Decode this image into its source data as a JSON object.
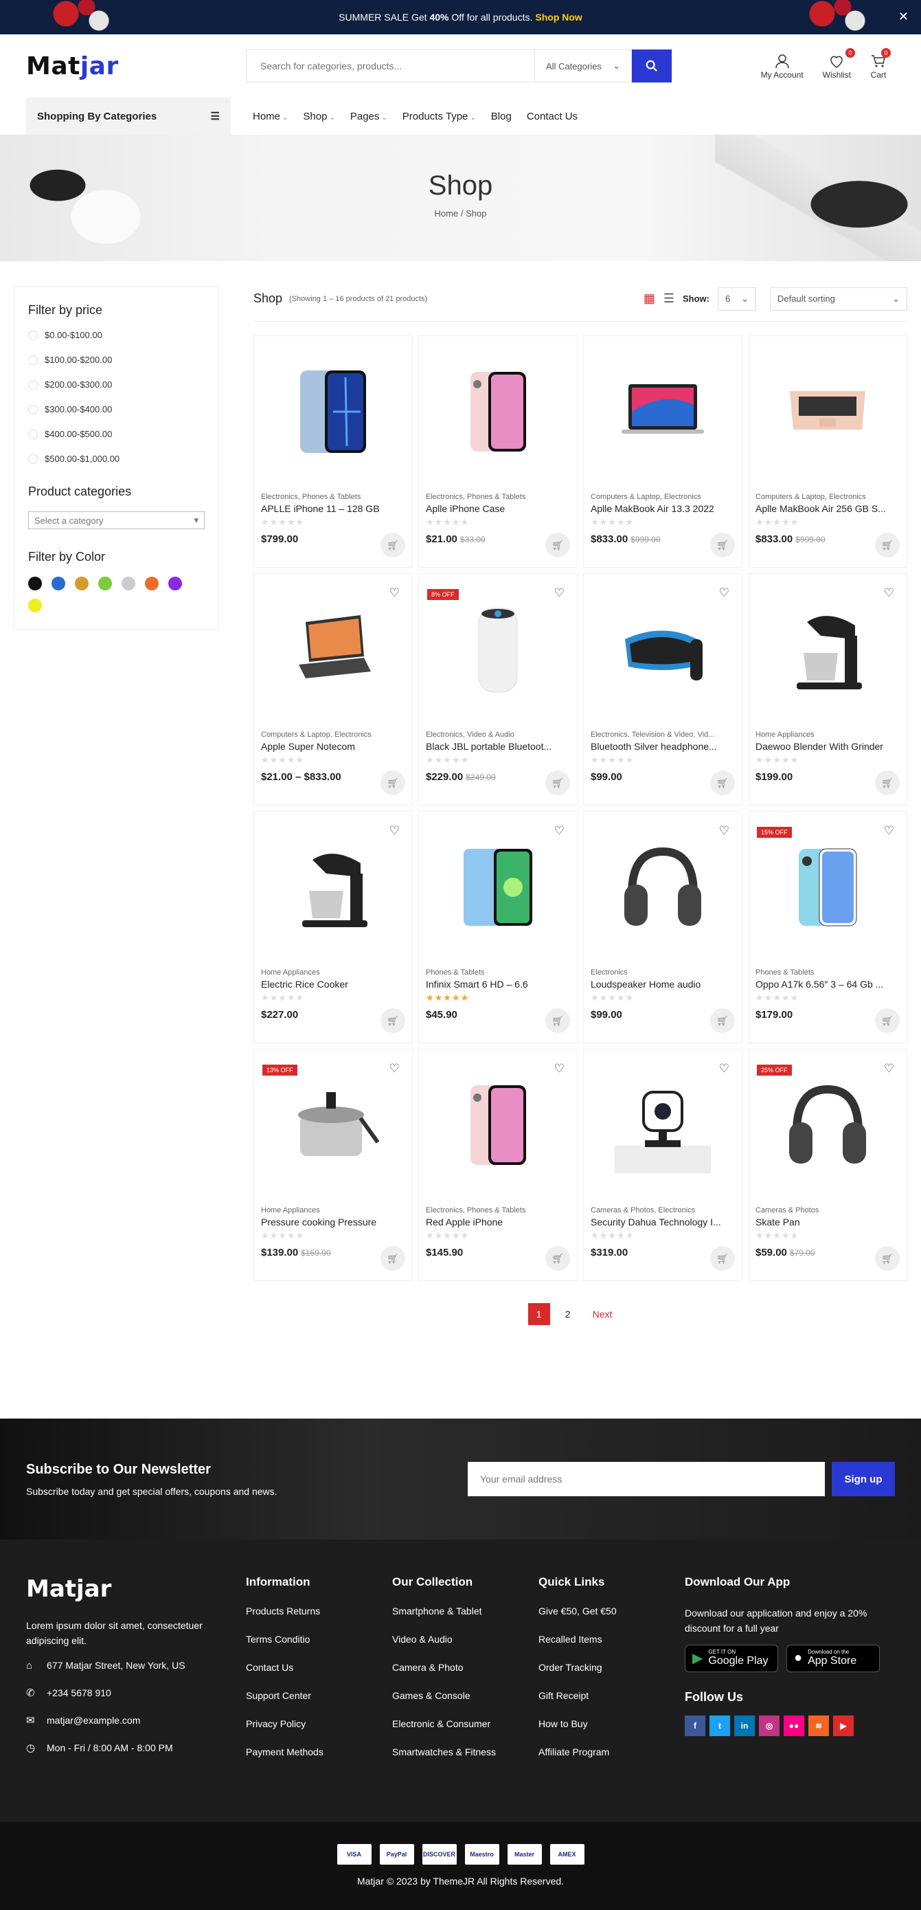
{
  "topbar": {
    "text_pre": "SUMMER SALE Get ",
    "text_bold": "40%",
    "text_post": " Off for all products.",
    "cta": "Shop Now",
    "close": "✕"
  },
  "header": {
    "logo_a": "Mat",
    "logo_b": "jar",
    "search_placeholder": "Search for categories, products...",
    "category_select": "All Categories",
    "account_label": "My Account",
    "wishlist_label": "Wishlist",
    "wishlist_count": "0",
    "cart_label": "Cart",
    "cart_count": "0"
  },
  "nav": {
    "categories_label": "Shopping By Categories",
    "menu": [
      {
        "label": "Home",
        "chevron": true
      },
      {
        "label": "Shop",
        "chevron": true
      },
      {
        "label": "Pages",
        "chevron": true
      },
      {
        "label": "Products Type",
        "chevron": true
      },
      {
        "label": "Blog",
        "chevron": false
      },
      {
        "label": "Contact Us",
        "chevron": false
      }
    ]
  },
  "hero": {
    "title": "Shop",
    "crumb_home": "Home",
    "crumb_sep": "/",
    "crumb_current": "Shop"
  },
  "sidebar": {
    "price_title": "Filter by price",
    "prices": [
      "$0.00-$100.00",
      "$100.00-$200.00",
      "$200.00-$300.00",
      "$300.00-$400.00",
      "$400.00-$500.00",
      "$500.00-$1,000.00"
    ],
    "categories_title": "Product categories",
    "category_placeholder": "Select a category",
    "color_title": "Filter by Color",
    "colors": [
      "#111111",
      "#2a6ad1",
      "#d99a2b",
      "#7ccb3a",
      "#cccccc",
      "#ee6a2d",
      "#8a2be2",
      "#eeee22"
    ]
  },
  "toolbar": {
    "title": "Shop",
    "count": "(Showing 1 – 16 products of 21 products)",
    "show_label": "Show:",
    "show_value": "6",
    "sort_value": "Default sorting"
  },
  "products": [
    {
      "cat": "Electronics, Phones & Tablets",
      "name": "APLLE iPhone 11 – 128 GB",
      "price": "$799.00",
      "old": "",
      "badge": "",
      "rated": false,
      "wish": false,
      "icon": "phone-blue-icon"
    },
    {
      "cat": "Electronics, Phones & Tablets",
      "name": "Aplle iPhone Case",
      "price": "$21.00",
      "old": "$33.00",
      "badge": "",
      "rated": false,
      "wish": false,
      "icon": "phone-pink-icon"
    },
    {
      "cat": "Computers & Laptop, Electronics",
      "name": "Aplle MakBook Air 13.3 2022",
      "price": "$833.00",
      "old": "$999.00",
      "badge": "",
      "rated": false,
      "wish": false,
      "icon": "laptop-icon"
    },
    {
      "cat": "Computers & Laptop, Electronics",
      "name": "Aplle MakBook Air 256 GB S...",
      "price": "$833.00",
      "old": "$999.00",
      "badge": "",
      "rated": false,
      "wish": false,
      "icon": "laptop-gold-icon"
    },
    {
      "cat": "Computers & Laptop, Electronics",
      "name": "Apple Super Notecom",
      "price": "$21.00 – $833.00",
      "old": "",
      "badge": "",
      "rated": false,
      "wish": true,
      "icon": "tablet-keyboard-icon"
    },
    {
      "cat": "Electronics, Video & Audio",
      "name": "Black JBL portable Bluetoot...",
      "price": "$229.00",
      "old": "$249.00",
      "badge": "8% OFF",
      "rated": false,
      "wish": true,
      "icon": "air-purifier-icon"
    },
    {
      "cat": "Electronics, Television & Video, Vid...",
      "name": "Bluetooth Silver headphone...",
      "price": "$99.00",
      "old": "",
      "badge": "",
      "rated": false,
      "wish": true,
      "icon": "vr-headset-icon"
    },
    {
      "cat": "Home Appliances",
      "name": "Daewoo Blender With Grinder",
      "price": "$199.00",
      "old": "",
      "badge": "",
      "rated": false,
      "wish": true,
      "icon": "stand-mixer-icon"
    },
    {
      "cat": "Home Appliances",
      "name": "Electric Rice Cooker",
      "price": "$227.00",
      "old": "",
      "badge": "",
      "rated": false,
      "wish": true,
      "icon": "stand-mixer-icon"
    },
    {
      "cat": "Phones & Tablets",
      "name": "Infinix Smart 6 HD – 6.6",
      "price": "$45.90",
      "old": "",
      "badge": "",
      "rated": true,
      "wish": true,
      "icon": "phone-android-icon"
    },
    {
      "cat": "Electronics",
      "name": "Loudspeaker Home audio",
      "price": "$99.00",
      "old": "",
      "badge": "",
      "rated": false,
      "wish": true,
      "icon": "headphones-icon"
    },
    {
      "cat": "Phones & Tablets",
      "name": "Oppo A17k 6.56″ 3 – 64 Gb ...",
      "price": "$179.00",
      "old": "",
      "badge": "15% OFF",
      "rated": false,
      "wish": true,
      "icon": "phone-oppo-icon"
    },
    {
      "cat": "Home Appliances",
      "name": "Pressure cooking Pressure",
      "price": "$139.00",
      "old": "$159.00",
      "badge": "13% OFF",
      "rated": false,
      "wish": true,
      "icon": "pressure-cooker-icon"
    },
    {
      "cat": "Electronics, Phones & Tablets",
      "name": "Red Apple iPhone",
      "price": "$145.90",
      "old": "",
      "badge": "",
      "rated": false,
      "wish": true,
      "icon": "phone-pink-icon"
    },
    {
      "cat": "Cameras & Photos, Electronics",
      "name": "Security Dahua Technology I...",
      "price": "$319.00",
      "old": "",
      "badge": "",
      "rated": false,
      "wish": true,
      "icon": "webcam-icon"
    },
    {
      "cat": "Cameras & Photos",
      "name": "Skate Pan",
      "price": "$59.00",
      "old": "$79.00",
      "badge": "25% OFF",
      "rated": false,
      "wish": true,
      "icon": "headphones-icon"
    }
  ],
  "pagination": {
    "p1": "1",
    "p2": "2",
    "next": "Next"
  },
  "newsletter": {
    "title": "Subscribe to Our Newsletter",
    "desc": "Subscribe today and get special offers, coupons and news.",
    "placeholder": "Your email address",
    "button": "Sign up"
  },
  "footer": {
    "logo": "Matjar",
    "desc": "Lorem ipsum dolor sit amet, consectetuer adipiscing elit.",
    "address": "677 Matjar Street, New York, US",
    "phone": "+234 5678 910",
    "email": "matjar@example.com",
    "hours": "Mon - Fri / 8:00 AM - 8:00 PM",
    "info_title": "Information",
    "info_links": [
      "Products Returns",
      "Terms Conditio",
      "Contact Us",
      "Support Center",
      "Privacy Policy",
      "Payment Methods"
    ],
    "collection_title": "Our Collection",
    "collection_links": [
      "Smartphone & Tablet",
      "Video & Audio",
      "Camera & Photo",
      "Games & Console",
      "Electronic & Consumer",
      "Smartwatches & Fitness"
    ],
    "quick_title": "Quick Links",
    "quick_links": [
      "Give €50, Get €50",
      "Recalled Items",
      "Order Tracking",
      "Gift Receipt",
      "How to Buy",
      "Affiliate Program"
    ],
    "app_title": "Download Our App",
    "app_desc": "Download our application and enjoy a 20% discount for a full year",
    "gp_small": "GET IT ON",
    "gp_big": "Google Play",
    "as_small": "Download on the",
    "as_big": "App Store",
    "follow_title": "Follow Us",
    "socials": [
      {
        "t": "f",
        "c": "#3b5998",
        "n": "facebook-icon"
      },
      {
        "t": "t",
        "c": "#1da1f2",
        "n": "twitter-icon"
      },
      {
        "t": "in",
        "c": "#0077b5",
        "n": "linkedin-icon"
      },
      {
        "t": "◎",
        "c": "#c13584",
        "n": "instagram-icon"
      },
      {
        "t": "●●",
        "c": "#ff0084",
        "n": "flickr-icon"
      },
      {
        "t": "≋",
        "c": "#f26522",
        "n": "rss-icon"
      },
      {
        "t": "▶",
        "c": "#e02a2a",
        "n": "youtube-icon"
      }
    ],
    "payments": [
      "VISA",
      "PayPal",
      "DISCOVER",
      "Maestro",
      "Master",
      "AMEX"
    ],
    "copyright": "Matjar © 2023 by  ThemeJR  All Rights Reserved."
  }
}
